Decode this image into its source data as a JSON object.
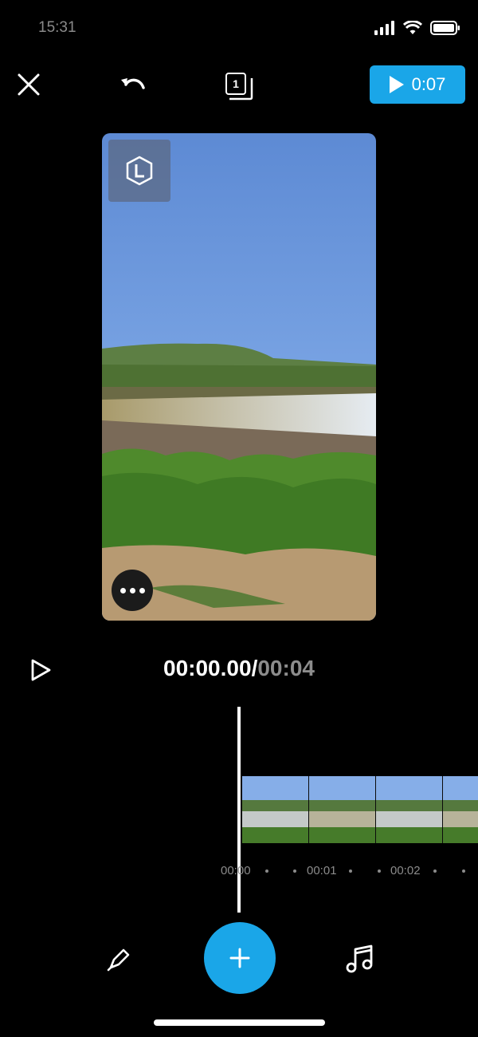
{
  "status_bar": {
    "time": "15:31"
  },
  "top_bar": {
    "layers_count": "1",
    "preview_duration": "0:07"
  },
  "player": {
    "current_time": "00:00.00",
    "separator": "/",
    "total_time": "00:04"
  },
  "timeline": {
    "markers": [
      "00:00",
      "00:01",
      "00:02"
    ]
  },
  "icons": [
    "close-icon",
    "undo-icon",
    "layers-icon",
    "play-icon",
    "watermark-logo-icon",
    "more-icon",
    "pen-icon",
    "plus-icon",
    "music-note-icon"
  ],
  "colors": {
    "accent": "#1aa6e8",
    "background": "#000000",
    "muted_text": "#8c8c8c"
  }
}
